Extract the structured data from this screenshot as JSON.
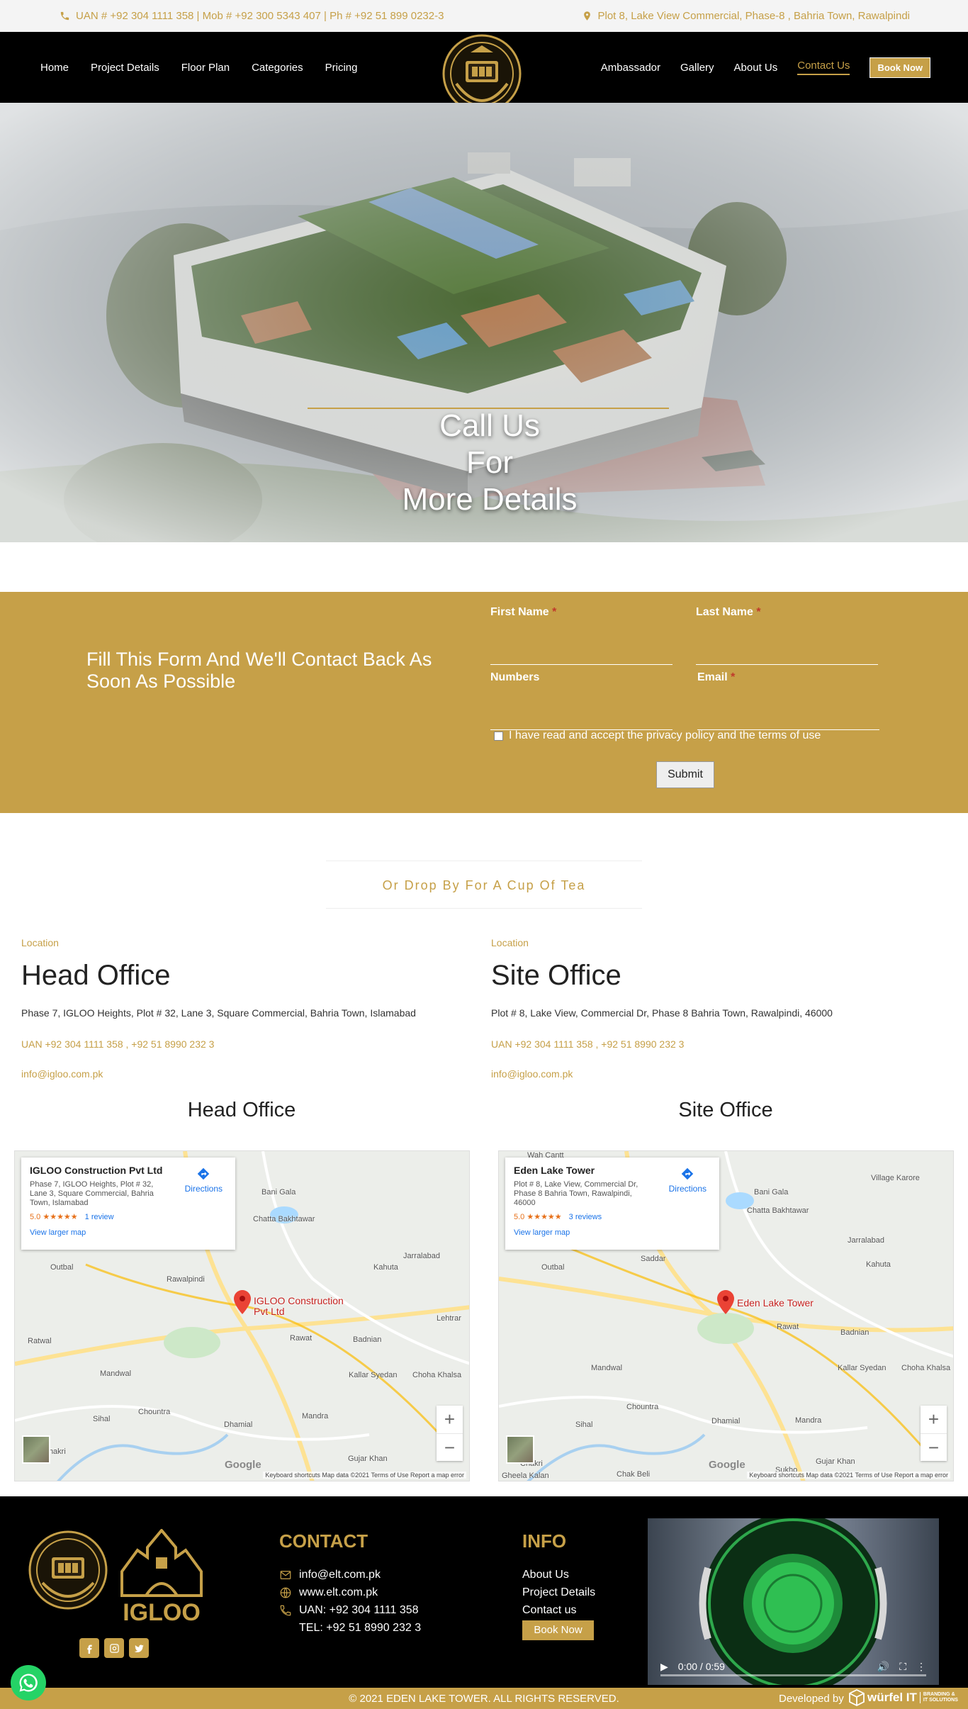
{
  "topbar": {
    "phones": "UAN # +92 304 1111 358 | Mob # +92 300 5343 407 | Ph # +92 51 899 0232-3",
    "address": "Plot 8, Lake View Commercial, Phase-8 , Bahria Town, Rawalpindi"
  },
  "nav": {
    "left": [
      "Home",
      "Project Details",
      "Floor Plan",
      "Categories",
      "Pricing"
    ],
    "right": [
      "Ambassador",
      "Gallery",
      "About Us",
      "Contact Us"
    ],
    "book_label": "Book Now"
  },
  "hero": {
    "line1": "Call Us",
    "line2": "For",
    "line3": "More Details"
  },
  "form": {
    "title": "Fill This Form And We'll Contact Back As Soon As Possible",
    "first_name": "First Name",
    "last_name": "Last Name",
    "numbers": "Numbers",
    "email": "Email",
    "required_mark": "*",
    "consent": "I have read and accept the privacy policy and the terms of use",
    "submit": "Submit"
  },
  "dropby": "Or Drop By For A Cup Of Tea",
  "offices": [
    {
      "label": "Location",
      "title": "Head Office",
      "address": "Phase 7, IGLOO Heights, Plot # 32, Lane 3, Square Commercial, Bahria Town, Islamabad",
      "phones": "UAN +92 304 1111 358 , +92 51 8990 232 3",
      "email": "info@igloo.com.pk",
      "map_title": "Head Office",
      "card_name": "IGLOO Construction Pvt Ltd",
      "card_address": "Phase 7, IGLOO Heights, Plot # 32, Lane 3, Square Commercial, Bahria Town, Islamabad",
      "rating": "5.0 ★★★★★",
      "reviews": "1 review",
      "larger": "View larger map",
      "directions": "Directions",
      "pin_label": "IGLOO Construction Pvt Ltd"
    },
    {
      "label": "Location",
      "title": "Site Office",
      "address": "Plot # 8, Lake View, Commercial Dr, Phase 8 Bahria Town, Rawalpindi, 46000",
      "phones": "UAN +92 304 1111 358 , +92 51 8990 232 3",
      "email": "info@igloo.com.pk",
      "map_title": "Site Office",
      "card_name": "Eden Lake Tower",
      "card_address": "Plot # 8, Lake View, Commercial Dr, Phase 8 Bahria Town, Rawalpindi, 46000",
      "rating": "5.0 ★★★★★",
      "reviews": "3 reviews",
      "larger": "View larger map",
      "directions": "Directions",
      "pin_label": "Eden Lake Tower"
    }
  ],
  "map_common": {
    "google": "Google",
    "footer": "Keyboard shortcuts   Map data ©2021   Terms of Use   Report a map error",
    "places_a": [
      "Bani Gala",
      "Chatta Bakhtawar",
      "Rawalpindi",
      "Jarralabad",
      "Kahuta",
      "Outbal",
      "Ratwal",
      "Mandwal",
      "Rawat",
      "Badnian",
      "Kallar Syedan",
      "Choha Khalsa",
      "Dhamial",
      "Chountra",
      "Sihal",
      "Mandra",
      "Gujar Khan",
      "Chakri",
      "Lehtrar"
    ],
    "places_b": [
      "Wah Cantt",
      "Bani Gala",
      "Village Karore",
      "Chatta Bakhtawar",
      "Jarralabad",
      "Kahuta",
      "Outbal",
      "Saddar",
      "Rawat",
      "Badnian",
      "Mandwal",
      "Kallar Syedan",
      "Choha Khalsa",
      "Dhamial",
      "Chountra",
      "Sihal",
      "Mandra",
      "Sukho",
      "Gujar Khan",
      "Chakri",
      "Chak Beli",
      "Gheela Kalan"
    ]
  },
  "footer": {
    "contact_heading": "CONTACT",
    "contact": {
      "email": "info@elt.com.pk",
      "web": "www.elt.com.pk",
      "uan": "UAN: +92 304 1111 358",
      "tel": "TEL:   +92 51 8990 232 3"
    },
    "info_heading": "INFO",
    "info_links": [
      "About Us",
      "Project Details",
      "Contact us"
    ],
    "book_label": "Book Now",
    "video_time": "0:00 / 0:59",
    "igloo_text": "IGLOO",
    "copyright": "© 2021 EDEN LAKE TOWER. ALL RIGHTS RESERVED.",
    "developed_by": "Developed by",
    "dev_brand": "würfel IT",
    "dev_brand_sub": "BRANDING & IT SOLUTIONS"
  },
  "colors": {
    "accent": "#c6a048",
    "nav_bg": "#000000",
    "topbar_bg": "#f4f4f4",
    "whatsapp": "#25d366"
  }
}
